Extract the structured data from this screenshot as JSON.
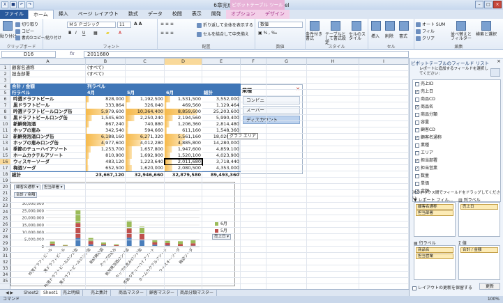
{
  "window": {
    "title": "6章完成.xlsx - Microsoft Excel",
    "context_tab_title": "ピボットテーブル ツール"
  },
  "ribbon_tabs": [
    "ファイル",
    "ホーム",
    "挿入",
    "ページ レイアウト",
    "数式",
    "データ",
    "校閲",
    "表示",
    "開発",
    "オプション",
    "デザイン"
  ],
  "ribbon": {
    "clipboard": {
      "paste": "貼り付け",
      "cut": "切り取り",
      "copy": "コピー",
      "format_painter": "書式のコピー/貼り付け",
      "label": "クリップボード"
    },
    "font": {
      "name": "ＭＳ Ｐゴシック",
      "size": "11",
      "label": "フォント"
    },
    "alignment": {
      "wrap": "折り返して全体を表示する",
      "merge": "セルを結合して中央揃え",
      "label": "配置"
    },
    "number": {
      "format": "数値",
      "label": "数値"
    },
    "styles": {
      "conditional": "条件付き書式",
      "table": "テーブルとして書式設定",
      "cell": "セルのスタイル",
      "label": "スタイル"
    },
    "cells": {
      "insert": "挿入",
      "delete": "削除",
      "format": "書式",
      "label": "セル"
    },
    "editing": {
      "autosum": "オート SUM",
      "fill": "フィル",
      "clear": "クリア",
      "sort": "並べ替えとフィルター",
      "find": "検索と選択",
      "label": "編集"
    }
  },
  "formula_bar": {
    "name_box": "D16",
    "fx": "fx",
    "value": "2011680"
  },
  "columns": [
    "A",
    "B",
    "C",
    "D",
    "E",
    "F",
    "G",
    "H",
    "I"
  ],
  "rows": [
    "1",
    "2",
    "3",
    "4",
    "5",
    "6",
    "7",
    "8",
    "9",
    "10",
    "11",
    "12",
    "13",
    "14",
    "15",
    "16",
    "17",
    "18",
    "19",
    "20",
    "21",
    "22",
    "23",
    "24",
    "25",
    "26",
    "27",
    "28",
    "29",
    "30",
    "31",
    "32",
    "33",
    "34",
    "35"
  ],
  "pivot": {
    "filters": [
      {
        "label": "顧客名通称",
        "value": "(すべて)"
      },
      {
        "label": "担当部署",
        "value": "(すべて)"
      }
    ],
    "value_label": "合計 / 金額",
    "col_label": "列ラベル",
    "row_label": "行ラベル",
    "months": [
      "4月",
      "5月",
      "6月"
    ],
    "total_label": "総計",
    "items": [
      {
        "name": "吟選ドラフトビール",
        "v": [
          "828,000",
          "1,192,500",
          "1,531,500",
          "3,552,000"
        ]
      },
      {
        "name": "黒ドラフトビール",
        "v": [
          "333,864",
          "326,040",
          "469,560",
          "1,129,464"
        ]
      },
      {
        "name": "吟選ドラフトビールロング缶",
        "v": [
          "5,979,600",
          "10,364,400",
          "8,859,600",
          "25,203,600"
        ]
      },
      {
        "name": "黒ドラフトビールロング缶",
        "v": [
          "1,545,600",
          "2,250,240",
          "2,194,560",
          "5,990,400"
        ]
      },
      {
        "name": "新鮮発泡酒",
        "v": [
          "867,240",
          "740,880",
          "1,206,360",
          "2,814,480"
        ]
      },
      {
        "name": "ホップの恵み",
        "v": [
          "342,540",
          "594,660",
          "611,160",
          "1,548,360"
        ]
      },
      {
        "name": "新鮮発泡酒ロング缶",
        "v": [
          "6,188,160",
          "6,271,320",
          "5,561,160",
          "18,020,640"
        ]
      },
      {
        "name": "ホップの恵みロング缶",
        "v": [
          "4,977,600",
          "4,012,280",
          "4,885,800",
          "14,280,000"
        ]
      },
      {
        "name": "季節のチューハイアソート",
        "v": [
          "1,253,700",
          "1,657,800",
          "1,947,600",
          "4,859,100"
        ]
      },
      {
        "name": "ホームカクテルアソート",
        "v": [
          "810,900",
          "1,692,900",
          "1,520,100",
          "4,023,900"
        ]
      },
      {
        "name": "ウィスキーソーダ",
        "v": [
          "483,120",
          "1,223,640",
          "2,011,680",
          "3,718,440"
        ]
      },
      {
        "name": "梅酒ソーダ",
        "v": [
          "652,500",
          "1,620,000",
          "2,080,500",
          "4,353,000"
        ]
      }
    ],
    "grand_total": [
      "23,667,120",
      "32,946,660",
      "32,879,580",
      "89,493,360"
    ]
  },
  "slicer": {
    "title": "業種",
    "items": [
      "コンビニ",
      "スーパー",
      "ディスカウント"
    ],
    "selected": "ディスカウント"
  },
  "chart_data": {
    "type": "bar",
    "stacked": true,
    "filters": [
      "顧客名通称",
      "担当部署"
    ],
    "value_button": "合計 / 金額",
    "legend_title": "売上日",
    "categories": [
      "吟選ドラフトビール",
      "黒ドラフトビール",
      "吟選ドラフトビールロング缶",
      "黒ドラフトビールロング缶",
      "新鮮発泡酒",
      "ホップの恵み",
      "新鮮発泡酒ロング缶",
      "ホップの恵みロング缶",
      "季節のチューハイアソート",
      "ホームカクテルアソート",
      "ウィスキーソーダ",
      "梅酒ソーダ"
    ],
    "series": [
      {
        "name": "4月",
        "values": [
          828000,
          333864,
          5979600,
          1545600,
          867240,
          342540,
          6188160,
          4977600,
          1253700,
          810900,
          483120,
          652500
        ],
        "color": "#4a7ebb"
      },
      {
        "name": "5月",
        "values": [
          1192500,
          326040,
          10364400,
          2250240,
          740880,
          594660,
          6271320,
          4012280,
          1657800,
          1692900,
          1223640,
          1620000
        ],
        "color": "#c0504d"
      },
      {
        "name": "6月",
        "values": [
          1531500,
          469560,
          8859600,
          2194560,
          1206360,
          611160,
          5561160,
          4885800,
          1947600,
          1520100,
          2011680,
          2080500
        ],
        "color": "#9bbb59"
      }
    ],
    "ylim": [
      0,
      30000000
    ],
    "yticks": [
      "0",
      "5,000,000",
      "10,000,000",
      "15,000,000",
      "20,000,000",
      "25,000,000",
      "30,000,000"
    ],
    "grid": true,
    "legend_position": "right"
  },
  "tooltip": "グラフ エリア",
  "sheet_tabs": [
    "Sheet2",
    "Sheet1",
    "売上明細",
    "売上集計",
    "商品マスター",
    "顧客マスター",
    "商品分類マスター"
  ],
  "active_sheet": "Sheet1",
  "status": {
    "mode": "コマンド",
    "zoom": "100%"
  },
  "field_pane": {
    "title": "ピボットテーブルのフィールド リスト",
    "instruction": "レポートに追加するフィールドを選択してください:",
    "fields": [
      {
        "name": "売上ID",
        "checked": false
      },
      {
        "name": "売上日",
        "checked": true
      },
      {
        "name": "商品CD",
        "checked": false
      },
      {
        "name": "商品名",
        "checked": true
      },
      {
        "name": "商品分類",
        "checked": false
      },
      {
        "name": "容量",
        "checked": false
      },
      {
        "name": "顧客CD",
        "checked": false
      },
      {
        "name": "顧客名通称",
        "checked": true
      },
      {
        "name": "業種",
        "checked": false
      },
      {
        "name": "エリア",
        "checked": false
      },
      {
        "name": "担当部署",
        "checked": true
      },
      {
        "name": "担当営業",
        "checked": true
      },
      {
        "name": "数量",
        "checked": false
      },
      {
        "name": "単価",
        "checked": false
      },
      {
        "name": "金額",
        "checked": true
      }
    ],
    "drag_instruction": "次のボックス間でフィールドをドラッグしてください:",
    "areas": {
      "filter": {
        "label": "レポート フィル...",
        "items": [
          "顧客名通称",
          "担当部署"
        ]
      },
      "columns": {
        "label": "列ラベル",
        "items": [
          "売上日"
        ]
      },
      "rows": {
        "label": "行ラベル",
        "items": [
          "商品名",
          "担当営業"
        ]
      },
      "values": {
        "label": "値",
        "items": [
          "合計 / 金額"
        ]
      }
    },
    "defer_label": "レイアウトの更新を保留する",
    "update_label": "更新"
  }
}
